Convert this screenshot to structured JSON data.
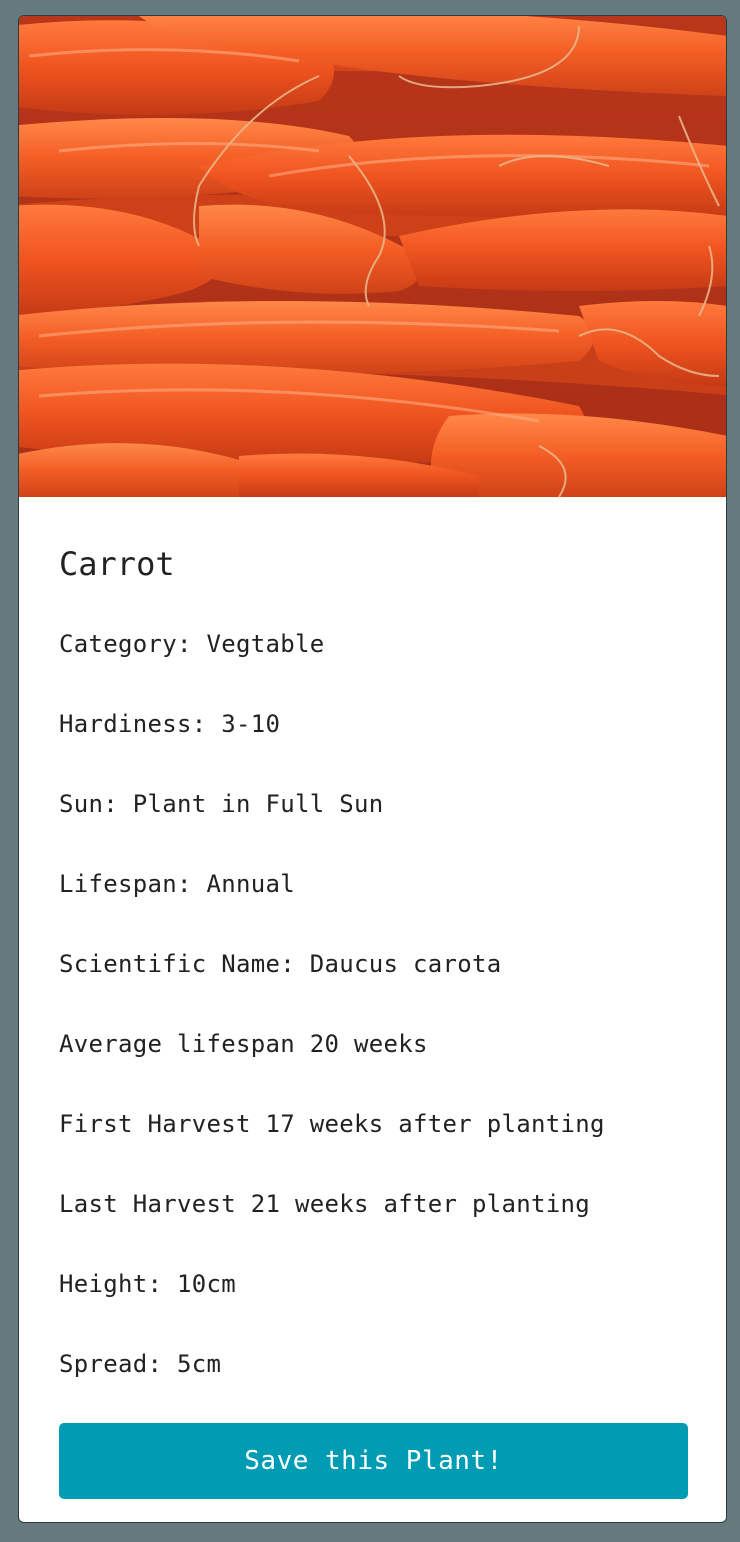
{
  "plant": {
    "name": "Carrot",
    "image_alt": "carrots-photo",
    "attributes": [
      "Category: Vegtable",
      "Hardiness: 3-10",
      "Sun: Plant in Full Sun",
      "Lifespan: Annual",
      "Scientific Name: Daucus carota",
      "Average lifespan 20 weeks",
      "First Harvest 17 weeks after planting",
      "Last Harvest 21 weeks after planting",
      "Height: 10cm",
      "Spread: 5cm"
    ]
  },
  "actions": {
    "save_label": "Save this Plant!"
  },
  "colors": {
    "page_background": "#647a7f",
    "card_background": "#ffffff",
    "button_background": "#009cb3",
    "button_text": "#ffffff",
    "text": "#222222"
  }
}
